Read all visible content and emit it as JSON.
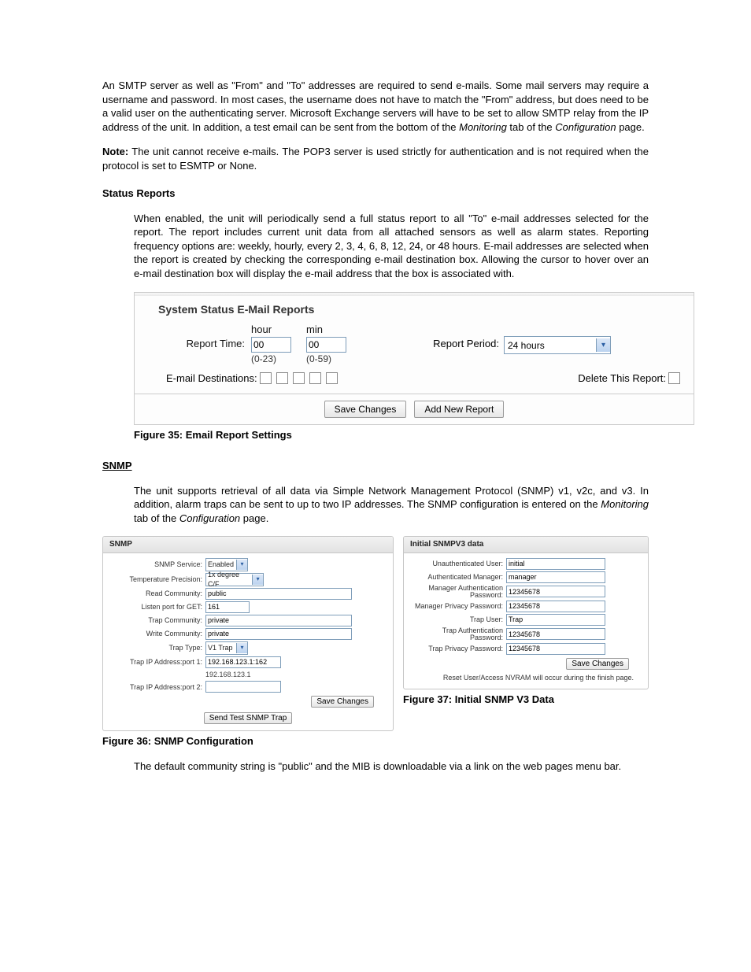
{
  "intro": "An SMTP server as well as \"From\" and \"To\" addresses are required to send e-mails.  Some mail servers may require a username and password.  In most cases, the username does not have to match the \"From\" address, but does need to be a valid user on the authenticating server. Microsoft Exchange servers will have to be set to allow SMTP relay from the IP address of the unit. In addition, a test email can be sent from the bottom of the ",
  "intro_italic1": "Monitoring",
  "intro_mid": " tab of the ",
  "intro_italic2": "Configuration",
  "intro_end": " page.",
  "note_label": "Note:",
  "note_text": " The unit cannot receive e-mails.  The POP3 server is used strictly for authentication and is not required when the protocol is set to ESMTP or None.",
  "status_heading": "Status Reports",
  "status_para": "When enabled, the unit will periodically send a full status report to all \"To\" e-mail addresses selected for the report.  The report includes current unit data from all attached sensors as well as alarm states.  Reporting frequency options are: weekly, hourly, every 2, 3, 4, 6, 8, 12, 24, or 48 hours.  E-mail addresses are selected when the report is created by checking the corresponding e-mail destination box.  Allowing the cursor to hover over an e-mail destination box will display the e-mail address that the box is associated with.",
  "fig35": {
    "title": "System Status E-Mail Reports",
    "report_time_label": "Report Time:",
    "hour_label": "hour",
    "hour_value": "00",
    "hour_range": "(0-23)",
    "min_label": "min",
    "min_value": "00",
    "min_range": "(0-59)",
    "period_label": "Report Period:",
    "period_value": "24 hours",
    "email_dest_label": "E-mail Destinations:",
    "delete_label": "Delete This Report:",
    "btn_save": "Save Changes",
    "btn_add": "Add New Report",
    "caption": "Figure 35: Email Report Settings"
  },
  "snmp_heading": "SNMP",
  "snmp_para_a": "The unit supports retrieval of all data via Simple Network Management Protocol (SNMP) v1, v2c, and v3.  In addition, alarm traps can be sent to up to two IP addresses.  The SNMP configuration is entered on the ",
  "snmp_para_it1": "Monitoring",
  "snmp_para_b": " tab of the ",
  "snmp_para_it2": "Configuration",
  "snmp_para_c": " page.",
  "fig36": {
    "panel_title": "SNMP",
    "snmp_service_label": "SNMP Service:",
    "snmp_service_value": "Enabled",
    "temp_prec_label": "Temperature Precision:",
    "temp_prec_value": "1x degree C/F",
    "read_comm_label": "Read Community:",
    "read_comm_value": "public",
    "listen_label": "Listen port for GET:",
    "listen_value": "161",
    "trap_comm_label": "Trap Community:",
    "trap_comm_value": "private",
    "write_comm_label": "Write Community:",
    "write_comm_value": "private",
    "trap_type_label": "Trap Type:",
    "trap_type_value": "V1 Trap",
    "trap1_label": "Trap IP Address:port 1:",
    "trap1_value": "192.168.123.1:162",
    "trap1_sub": "192.168.123.1",
    "trap2_label": "Trap IP Address:port 2:",
    "trap2_value": "",
    "btn_save": "Save Changes",
    "btn_test": "Send Test SNMP Trap",
    "caption": "Figure 36: SNMP Configuration"
  },
  "fig37": {
    "panel_title": "Initial SNMPV3 data",
    "unauth_label": "Unauthenticated User:",
    "unauth_value": "initial",
    "authmgr_label": "Authenticated Manager:",
    "authmgr_value": "manager",
    "mgrauth_label": "Manager Authentication Password:",
    "mgrauth_value": "12345678",
    "mgrpriv_label": "Manager Privacy Password:",
    "mgrpriv_value": "12345678",
    "trapuser_label": "Trap User:",
    "trapuser_value": "Trap",
    "trapauth_label": "Trap Authentication Password:",
    "trapauth_value": "12345678",
    "trappriv_label": "Trap Privacy Password:",
    "trappriv_value": "12345678",
    "btn_save": "Save Changes",
    "hint": "Reset User/Access NVRAM will occur during the finish page.",
    "caption": "Figure 37: Initial SNMP V3 Data"
  },
  "closing": "The default community string is \"public\" and the MIB is downloadable via a link on the web pages menu bar."
}
